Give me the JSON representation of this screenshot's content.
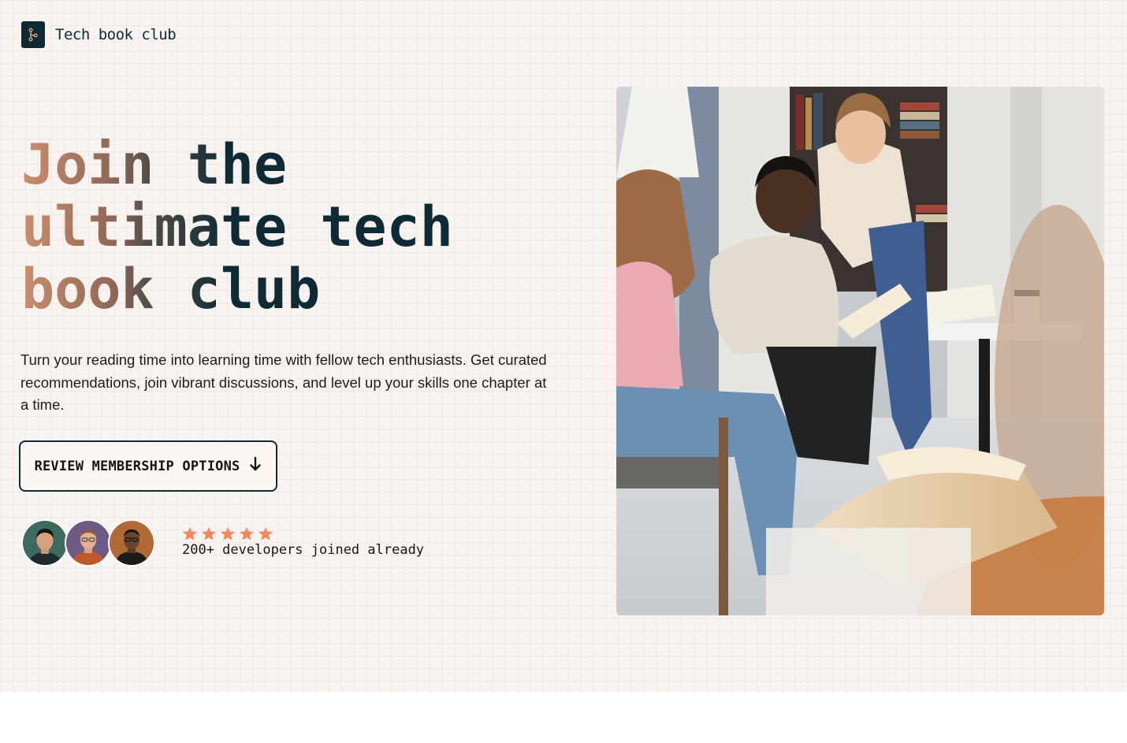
{
  "brand": {
    "name": "Tech book club",
    "logo_icon": "git-branch-icon",
    "colors": {
      "navy": "#0e2a35",
      "accent": "#cb8e6e",
      "star": "#f08a5d"
    }
  },
  "hero": {
    "headline": [
      "Join the",
      "ultimate tech",
      "book club"
    ],
    "lead": "Turn your reading time into learning time with fellow tech enthusiasts. Get curated recommendations, join vibrant discussions, and level up your skills one chapter at a time.",
    "cta_label": "REVIEW MEMBERSHIP OPTIONS",
    "cta_icon": "arrow-down-icon",
    "social_proof": {
      "rating_stars": 5,
      "text": "200+ developers joined already",
      "avatar_count": 3
    },
    "image_icon": "book-club-photo"
  }
}
